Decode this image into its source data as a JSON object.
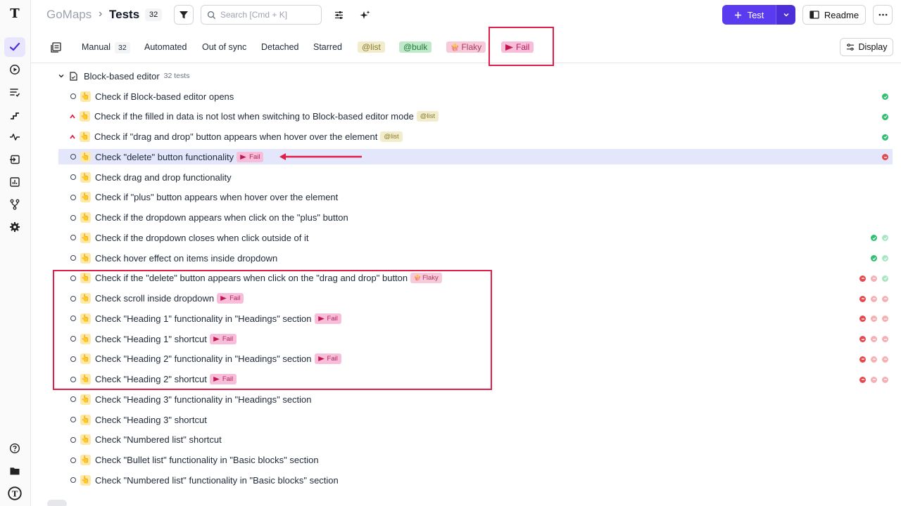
{
  "header": {
    "project": "GoMaps",
    "page": "Tests",
    "count": "32",
    "search_placeholder": "Search [Cmd + K]",
    "new_test_label": "Test",
    "readme_label": "Readme"
  },
  "tabs": {
    "manual": "Manual",
    "manual_count": "32",
    "automated": "Automated",
    "out_of_sync": "Out of sync",
    "detached": "Detached",
    "starred": "Starred",
    "tag_list": "@list",
    "tag_bulk": "@bulk",
    "label_flaky": "Flaky",
    "label_fail": "Fail",
    "display": "Display"
  },
  "suite": {
    "title": "Block-based editor",
    "sub": "32 tests"
  },
  "rows": [
    {
      "title": "Check if Block-based editor opens",
      "tag": "",
      "status": [
        "pass"
      ]
    },
    {
      "title": "Check if the filled in data is not lost when switching to Block-based editor mode",
      "tag": "@list",
      "status": [
        "pass"
      ]
    },
    {
      "title": "Check if \"drag and drop\" button appears when hover over the element",
      "tag": "@list",
      "status": [
        "pass"
      ]
    },
    {
      "title": "Check \"delete\" button functionality",
      "tag": "Fail",
      "status": [
        "fail"
      ]
    },
    {
      "title": "Check drag and drop functionality",
      "tag": "",
      "status": []
    },
    {
      "title": "Check if \"plus\" button appears when hover over the element",
      "tag": "",
      "status": []
    },
    {
      "title": "Check if the dropdown appears when click on the \"plus\" button",
      "tag": "",
      "status": []
    },
    {
      "title": "Check if the dropdown closes when click outside of it",
      "tag": "",
      "status": [
        "pass",
        "pass-light"
      ]
    },
    {
      "title": "Check hover effect on items inside dropdown",
      "tag": "",
      "status": [
        "pass",
        "pass-light"
      ]
    },
    {
      "title": "Check if the \"delete\" button appears when click on the \"drag and drop\" button",
      "tag": "Flaky",
      "status": [
        "fail",
        "fail-light",
        "pass-light"
      ]
    },
    {
      "title": "Check scroll inside dropdown",
      "tag": "Fail",
      "status": [
        "fail",
        "fail-light",
        "fail-light"
      ]
    },
    {
      "title": "Check \"Heading 1\" functionality in \"Headings\" section",
      "tag": "Fail",
      "status": [
        "fail",
        "fail-light",
        "fail-light"
      ]
    },
    {
      "title": "Check \"Heading 1\" shortcut",
      "tag": "Fail",
      "status": [
        "fail",
        "fail-light",
        "fail-light"
      ]
    },
    {
      "title": "Check \"Heading 2\" functionality in \"Headings\" section",
      "tag": "Fail",
      "status": [
        "fail",
        "fail-light",
        "fail-light"
      ]
    },
    {
      "title": "Check \"Heading 2\" shortcut",
      "tag": "Fail",
      "status": [
        "fail",
        "fail-light",
        "fail-light"
      ]
    },
    {
      "title": "Check \"Heading 3\" functionality in \"Headings\" section",
      "tag": "",
      "status": []
    },
    {
      "title": "Check \"Heading 3\" shortcut",
      "tag": "",
      "status": []
    },
    {
      "title": "Check \"Numbered list\" shortcut",
      "tag": "",
      "status": []
    },
    {
      "title": "Check \"Bullet list\" functionality in \"Basic blocks\" section",
      "tag": "",
      "status": []
    },
    {
      "title": "Check \"Numbered list\" functionality in \"Basic blocks\" section",
      "tag": "",
      "status": []
    }
  ],
  "colors": {
    "accent": "#5b3bf0",
    "highlight_box": "#e11d48",
    "pass": "#2fbf71",
    "fail": "#e5484d"
  }
}
